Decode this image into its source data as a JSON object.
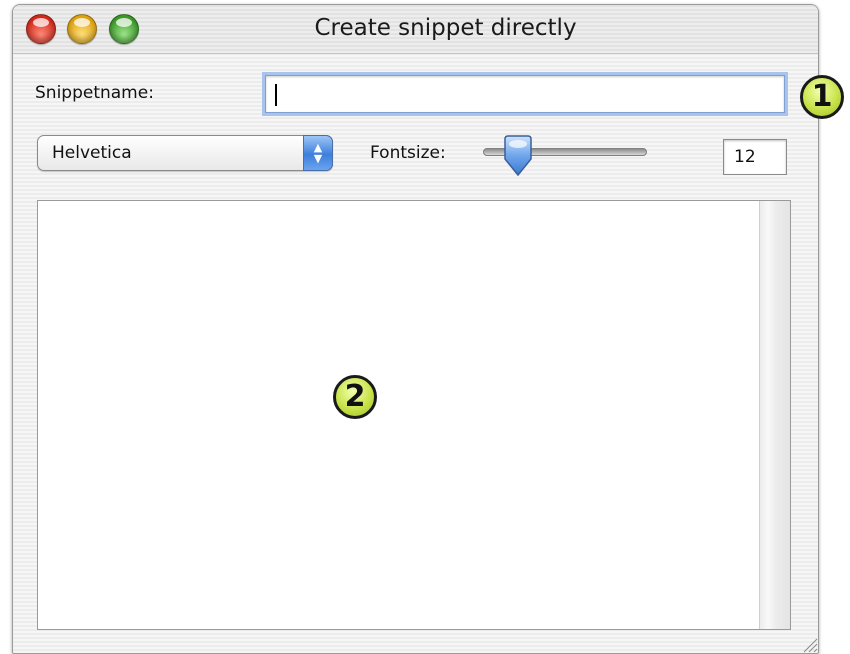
{
  "window": {
    "title": "Create snippet directly"
  },
  "form": {
    "snippet_name_label": "Snippetname:",
    "snippet_name_value": "",
    "font_selected": "Helvetica",
    "fontsize_label": "Fontsize:",
    "fontsize_value": "12",
    "fontsize_slider_level": 0.25,
    "text_content": ""
  },
  "annotations": {
    "badge_1": "1",
    "badge_2": "2"
  },
  "colors": {
    "close": "#d32a1b",
    "minimize": "#e0a312",
    "zoom": "#3c9a2a",
    "focus_ring": "#a9c4ec",
    "badge_fill": "#c8e34a"
  },
  "icons": {
    "close": "close-icon",
    "minimize": "minimize-icon",
    "zoom": "zoom-icon",
    "popup_arrows": "up-down-arrows-icon",
    "resize": "resize-grip-icon"
  }
}
